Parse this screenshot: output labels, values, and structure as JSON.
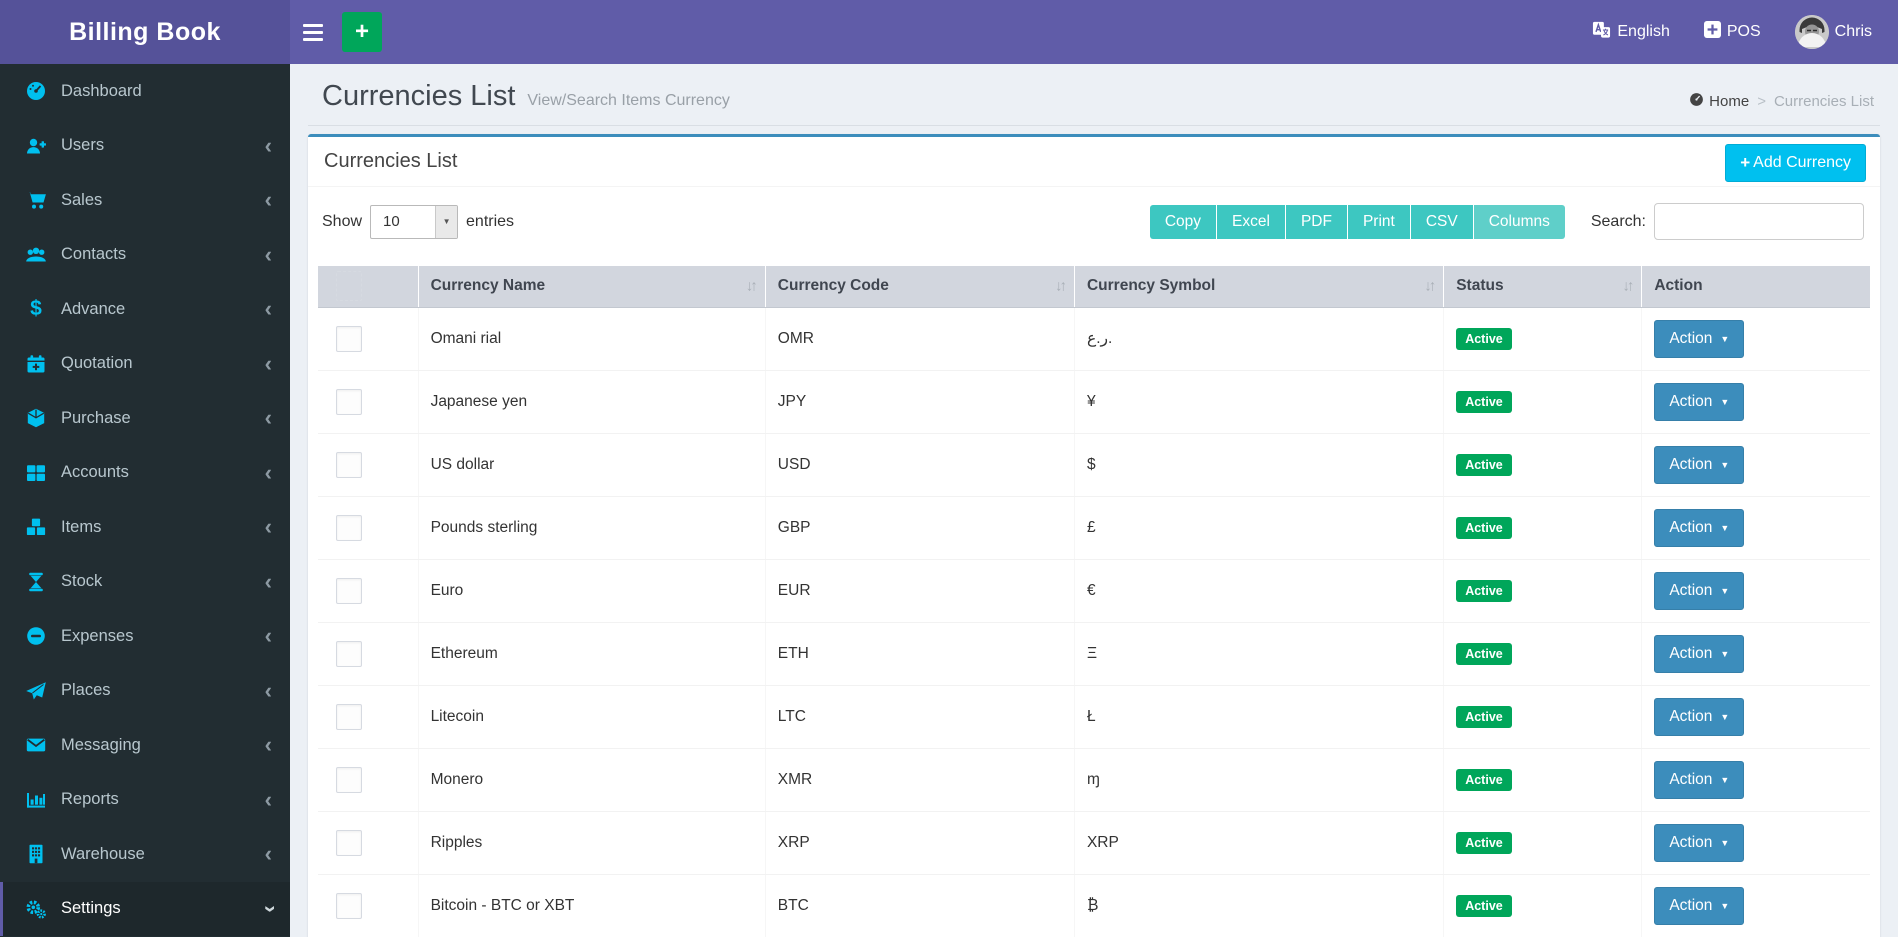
{
  "app": {
    "title": "Billing Book"
  },
  "navbar": {
    "language": "English",
    "pos": "POS",
    "user": "Chris"
  },
  "icons": {
    "plus": "+",
    "caret_down": "▼",
    "chevron_left": "‹",
    "select_arrow": "▼",
    "arrow_down": "↓",
    "arrow_up": "↑",
    "breadcrumb_sep": ">"
  },
  "colors": {
    "navbar": "#605CA8",
    "logo_bg": "#555299",
    "sidebar": "#222D32",
    "sidebar_icon": "#00C0EF",
    "panel_border": "#3C8DBC",
    "add_button": "#00C0EF",
    "export_buttons": "#3DC7C1",
    "status_active": "#00A65A",
    "action_button": "#3C8DBC",
    "header_add": "#00A65A"
  },
  "sidebar": {
    "items": [
      {
        "label": "Dashboard",
        "icon": "dashboard",
        "active": false,
        "expandable": false
      },
      {
        "label": "Users",
        "icon": "user-plus",
        "active": false,
        "expandable": true
      },
      {
        "label": "Sales",
        "icon": "shopping-cart",
        "active": false,
        "expandable": true
      },
      {
        "label": "Contacts",
        "icon": "users-group",
        "active": false,
        "expandable": true
      },
      {
        "label": "Advance",
        "icon": "dollar",
        "active": false,
        "expandable": true
      },
      {
        "label": "Quotation",
        "icon": "calendar-plus",
        "active": false,
        "expandable": true
      },
      {
        "label": "Purchase",
        "icon": "cube",
        "active": false,
        "expandable": true
      },
      {
        "label": "Accounts",
        "icon": "grid",
        "active": false,
        "expandable": true
      },
      {
        "label": "Items",
        "icon": "cubes",
        "active": false,
        "expandable": true
      },
      {
        "label": "Stock",
        "icon": "hourglass",
        "active": false,
        "expandable": true
      },
      {
        "label": "Expenses",
        "icon": "minus-circle",
        "active": false,
        "expandable": true
      },
      {
        "label": "Places",
        "icon": "paper-plane",
        "active": false,
        "expandable": true
      },
      {
        "label": "Messaging",
        "icon": "envelope",
        "active": false,
        "expandable": true
      },
      {
        "label": "Reports",
        "icon": "bar-chart",
        "active": false,
        "expandable": true
      },
      {
        "label": "Warehouse",
        "icon": "building",
        "active": false,
        "expandable": true
      },
      {
        "label": "Settings",
        "icon": "gears",
        "active": true,
        "expandable": true
      }
    ]
  },
  "page": {
    "title": "Currencies List",
    "subtitle": "View/Search Items Currency",
    "breadcrumb": {
      "home": "Home",
      "current": "Currencies List"
    }
  },
  "panel": {
    "title": "Currencies List",
    "add_button_label": "Add Currency"
  },
  "toolbar": {
    "show_label": "Show",
    "page_size": "10",
    "entries_label": "entries",
    "buttons": [
      "Copy",
      "Excel",
      "PDF",
      "Print",
      "CSV",
      "Columns"
    ],
    "search_label": "Search:",
    "search_value": ""
  },
  "table": {
    "action_label": "Action",
    "columns": [
      "Currency Name",
      "Currency Code",
      "Currency Symbol",
      "Status",
      "Action"
    ],
    "rows": [
      {
        "name": "Omani rial",
        "code": "OMR",
        "symbol": "ر.ع.",
        "status": "Active"
      },
      {
        "name": "Japanese yen",
        "code": "JPY",
        "symbol": "¥",
        "status": "Active"
      },
      {
        "name": "US dollar",
        "code": "USD",
        "symbol": "$",
        "status": "Active"
      },
      {
        "name": "Pounds sterling",
        "code": "GBP",
        "symbol": "£",
        "status": "Active"
      },
      {
        "name": "Euro",
        "code": "EUR",
        "symbol": "€",
        "status": "Active"
      },
      {
        "name": "Ethereum",
        "code": "ETH",
        "symbol": "Ξ",
        "status": "Active"
      },
      {
        "name": "Litecoin",
        "code": "LTC",
        "symbol": "Ł",
        "status": "Active"
      },
      {
        "name": "Monero",
        "code": "XMR",
        "symbol": "ɱ",
        "status": "Active"
      },
      {
        "name": "Ripples",
        "code": "XRP",
        "symbol": "XRP",
        "status": "Active"
      },
      {
        "name": "Bitcoin - BTC or XBT",
        "code": "BTC",
        "symbol": "₿",
        "status": "Active"
      }
    ]
  }
}
